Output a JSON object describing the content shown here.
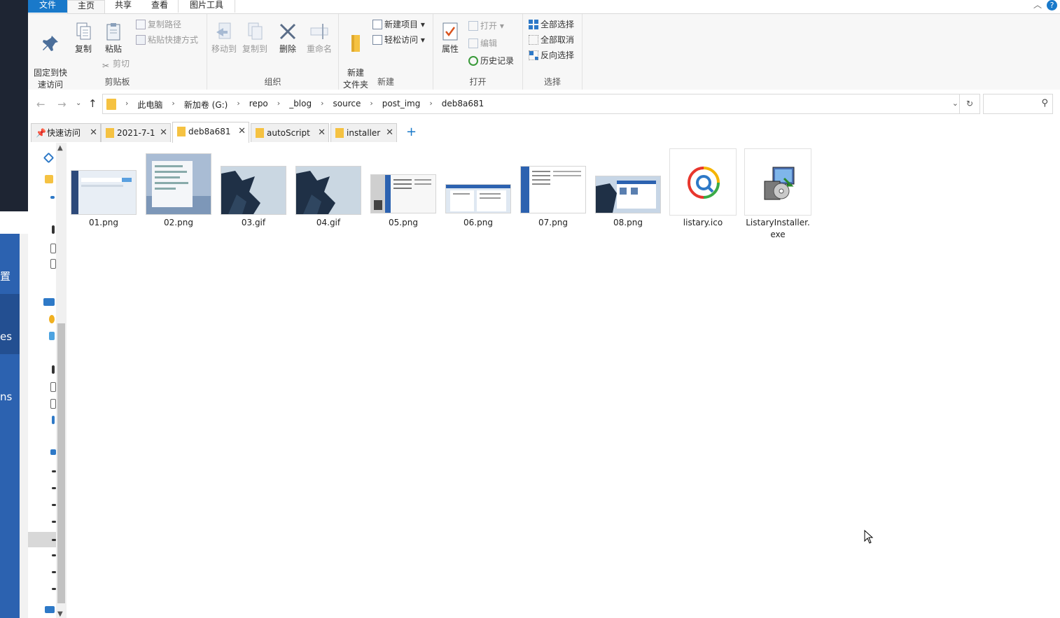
{
  "background_app": {
    "labels": [
      "置",
      "es",
      "ns"
    ]
  },
  "menu": {
    "tabs": [
      "文件",
      "主页",
      "共享",
      "查看",
      "图片工具"
    ],
    "active": "主页",
    "collapse_icon": "chevron-up-icon",
    "help_label": "?"
  },
  "ribbon": {
    "clipboard": {
      "pin_label": "固定到快\n速访问",
      "copy_label": "复制",
      "paste_label": "粘贴",
      "copy_path_label": "复制路径",
      "paste_shortcut_label": "粘贴快捷方式",
      "cut_label": "剪切",
      "group_label": "剪贴板"
    },
    "organize": {
      "move_to_label": "移动到",
      "copy_to_label": "复制到",
      "delete_label": "删除",
      "rename_label": "重命名",
      "group_label": "组织"
    },
    "new": {
      "new_folder_label": "新建\n文件夹",
      "new_item_label": "新建项目",
      "easy_access_label": "轻松访问",
      "group_label": "新建"
    },
    "open": {
      "properties_label": "属性",
      "open_label": "打开",
      "edit_label": "编辑",
      "history_label": "历史记录",
      "group_label": "打开"
    },
    "select": {
      "select_all_label": "全部选择",
      "select_none_label": "全部取消",
      "invert_label": "反向选择",
      "group_label": "选择"
    }
  },
  "address": {
    "crumbs": [
      "此电脑",
      "新加卷 (G:)",
      "repo",
      "_blog",
      "source",
      "post_img",
      "deb8a681"
    ],
    "separator": "›"
  },
  "search": {
    "placeholder": ""
  },
  "folder_tabs": {
    "tabs": [
      {
        "label": "快速访问",
        "icon": "pin-icon"
      },
      {
        "label": "2021-7-1",
        "icon": "folder-icon"
      },
      {
        "label": "deb8a681",
        "icon": "folder-icon",
        "active": true
      },
      {
        "label": "autoScript",
        "icon": "folder-icon"
      },
      {
        "label": "installer",
        "icon": "folder-icon"
      }
    ],
    "close_glyph": "✕",
    "add_glyph": "+"
  },
  "files": [
    {
      "name": "01.png",
      "kind": "screenshot-light"
    },
    {
      "name": "02.png",
      "kind": "screenshot-menu"
    },
    {
      "name": "03.gif",
      "kind": "cloud-photo"
    },
    {
      "name": "04.gif",
      "kind": "cloud-photo"
    },
    {
      "name": "05.png",
      "kind": "screenshot-explorer"
    },
    {
      "name": "06.png",
      "kind": "screenshot-explorer"
    },
    {
      "name": "07.png",
      "kind": "screenshot-explorer"
    },
    {
      "name": "08.png",
      "kind": "screenshot-desktop"
    },
    {
      "name": "listary.ico",
      "kind": "listary-logo"
    },
    {
      "name": "ListaryInstaller.\nexe",
      "kind": "installer-icon"
    }
  ],
  "colors": {
    "accent": "#1979ca",
    "folder": "#f5c242",
    "bg_app_dark": "#1e2533",
    "bg_app_blue": "#2c62b0"
  }
}
